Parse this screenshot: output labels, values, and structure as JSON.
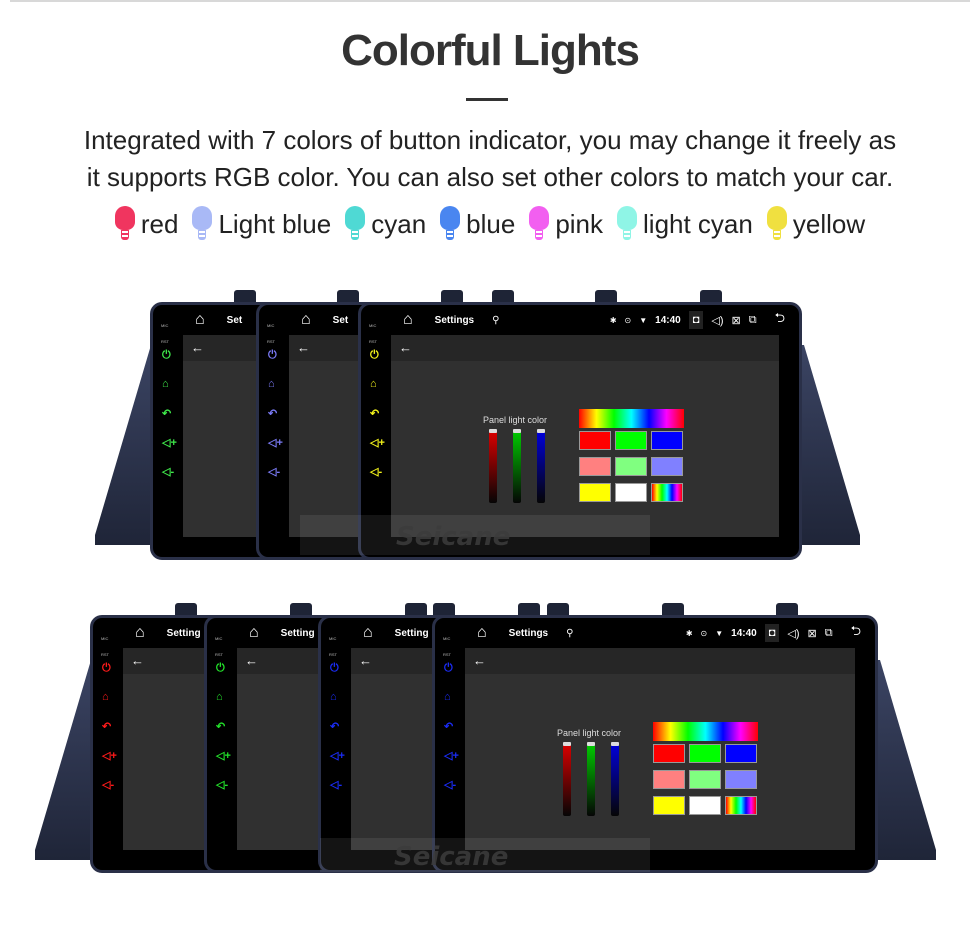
{
  "header": {
    "title": "Colorful Lights",
    "description_line1": "Integrated with 7 colors of button indicator, you may change it freely as",
    "description_line2": "it supports RGB color. You can also set other colors to match your car."
  },
  "legend": [
    {
      "label": "red",
      "color": "#f0355f",
      "icon": "bulb-icon"
    },
    {
      "label": "Light blue",
      "color": "#a9b9f6",
      "icon": "bulb-icon"
    },
    {
      "label": "cyan",
      "color": "#4fd9d4",
      "icon": "bulb-icon"
    },
    {
      "label": "blue",
      "color": "#4a86f0",
      "icon": "bulb-icon"
    },
    {
      "label": "pink",
      "color": "#f25ff0",
      "icon": "bulb-icon"
    },
    {
      "label": "light cyan",
      "color": "#8ff5e6",
      "icon": "bulb-icon"
    },
    {
      "label": "yellow",
      "color": "#f0e040",
      "icon": "bulb-icon"
    }
  ],
  "device": {
    "status_title": "Settings",
    "status_title_truncated": "Set",
    "status_title_truncated2": "Setting",
    "time": "14:40",
    "mic_label": "MIC",
    "rst_label": "RST",
    "back_arrow": "←",
    "panel_title": "Panel light color",
    "watermark": "Seicane",
    "icons": {
      "home": "⌂",
      "usb": "⚲",
      "bluetooth": "✱",
      "location": "⊙",
      "wifi": "▼",
      "camera": "◘",
      "volume": "◁)",
      "close": "⊠",
      "windows": "⧉",
      "return": "⮌",
      "power": "⏻",
      "back": "↶",
      "vol_up": "◁+",
      "vol_down": "◁-"
    },
    "row1_indicator_colors": [
      "#3ee84a",
      "#7a7af5",
      "#f2f21a"
    ],
    "row2_indicator_colors": [
      "#ff1a1a",
      "#22e02a",
      "#1a2cf5",
      "#1a2cf5"
    ],
    "swatches": [
      "#ff0000",
      "#00ff00",
      "#0000ff",
      "#ff8080",
      "#80ff80",
      "#8080ff",
      "#ffff00",
      "#ffffff",
      "rainbow"
    ],
    "sliders": [
      {
        "channel": "R",
        "color": "#e00000",
        "value": 1.0
      },
      {
        "channel": "G",
        "color": "#00d000",
        "value": 1.0
      },
      {
        "channel": "B",
        "color": "#0000e0",
        "value": 1.0
      }
    ]
  }
}
